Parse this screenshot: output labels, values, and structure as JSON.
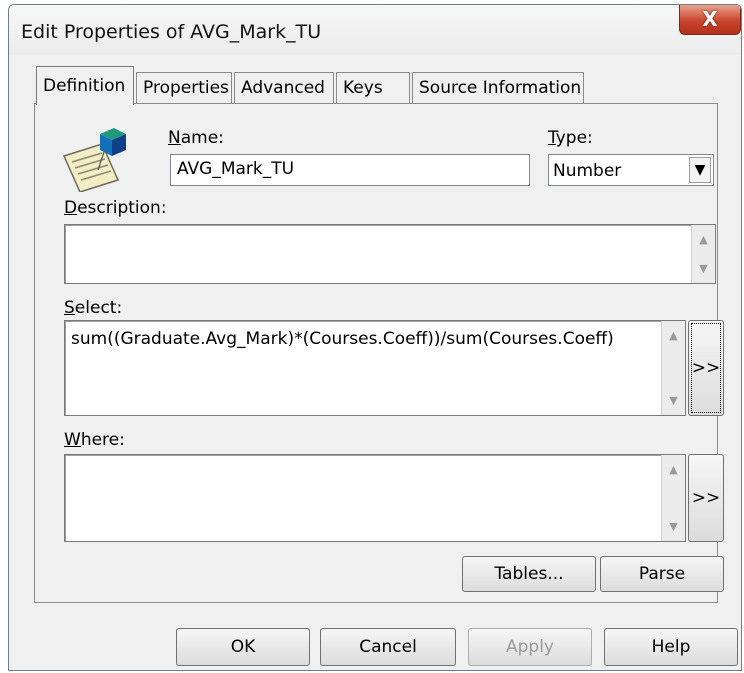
{
  "window": {
    "title": "Edit Properties of AVG_Mark_TU",
    "close_glyph": "X"
  },
  "tabs": [
    {
      "label": "Definition",
      "active": true
    },
    {
      "label": "Properties",
      "active": false
    },
    {
      "label": "Advanced",
      "active": false
    },
    {
      "label": "Keys",
      "active": false
    },
    {
      "label": "Source Information",
      "active": false
    }
  ],
  "form": {
    "name_label": "Name:",
    "name_value": "AVG_Mark_TU",
    "type_label": "Type:",
    "type_value": "Number",
    "description_label": "Description:",
    "description_value": "",
    "select_label": "Select:",
    "select_value": "sum((Graduate.Avg_Mark)*(Courses.Coeff))/sum(Courses.Coeff)",
    "select_builder_label": ">>",
    "where_label": "Where:",
    "where_value": "",
    "where_builder_label": ">>"
  },
  "panel_buttons": {
    "tables": "Tables...",
    "parse": "Parse"
  },
  "footer_buttons": {
    "ok": "OK",
    "cancel": "Cancel",
    "apply": "Apply",
    "help": "Help"
  },
  "icons": {
    "object": "object-properties-icon"
  },
  "colors": {
    "close": "#c8442d",
    "window_bg": "#f0f0f0"
  }
}
